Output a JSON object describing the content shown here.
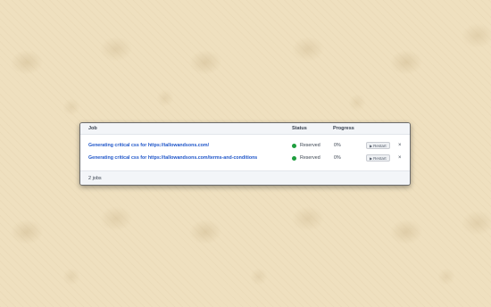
{
  "table": {
    "columns": {
      "job": "Job",
      "status": "Status",
      "progress": "Progress"
    },
    "rows": [
      {
        "job": "Generating critical css for https://tallowandsons.com/",
        "status": "Reserved",
        "progress": "0%",
        "restart": "Restart",
        "close": "×"
      },
      {
        "job": "Generating critical css for https://tallowandsons.com/terms-and-conditions",
        "status": "Reserved",
        "progress": "0%",
        "restart": "Restart",
        "close": "×"
      }
    ],
    "footer": "2 jobs"
  },
  "icons": {
    "status": "status-dot-icon",
    "restart": "play-icon",
    "close": "close-icon"
  },
  "colors": {
    "link": "#1f56c9",
    "status_reserved": "#1e9e3e",
    "wallpaper": "#efe0bf"
  }
}
